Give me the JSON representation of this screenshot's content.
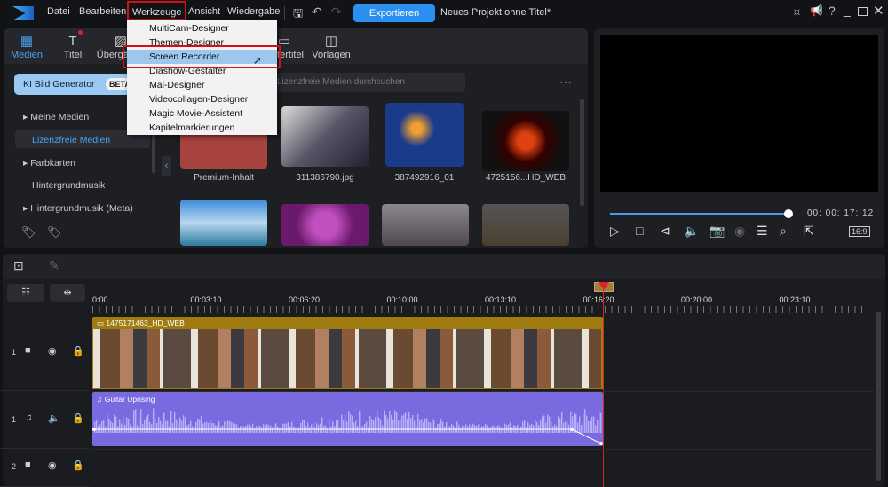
{
  "menubar": {
    "items": [
      "Datei",
      "Bearbeiten",
      "Werkzeuge",
      "Ansicht",
      "Wiedergabe"
    ],
    "export_label": "Exportieren",
    "project_title": "Neues Projekt ohne Titel*"
  },
  "werkzeuge_menu": {
    "items": [
      "MultiCam-Designer",
      "Themen-Designer",
      "Screen Recorder",
      "Diashow-Gestalter",
      "Mal-Designer",
      "Videocollagen-Designer",
      "Magic Movie-Assistent",
      "Kapitelmarkierungen"
    ],
    "highlighted": "Screen Recorder"
  },
  "tabs": [
    "Medien",
    "Titel",
    "Übergänge",
    "Untertitel",
    "Vorlagen"
  ],
  "ai_generator": {
    "label": "KI Bild Generator",
    "badge": "BETA"
  },
  "search": {
    "placeholder": "Lizenzfreie Medien durchsuchen"
  },
  "sidebar": {
    "items": [
      "Meine Medien",
      "Lizenzfreie Medien",
      "Farbkarten",
      "Hintergrundmusik",
      "Hintergrundmusik (Meta)"
    ],
    "active": "Lizenzfreie Medien"
  },
  "media": {
    "row1": [
      "Premium-Inhalt",
      "311386790.jpg",
      "387492916_01",
      "4725156...HD_WEB"
    ]
  },
  "preview": {
    "timecode": "00: 00: 17: 12",
    "aspect": "16:9",
    "progress": 0.97
  },
  "timeline": {
    "ruler": [
      "0:00",
      "00:03:10",
      "00:06:20",
      "00:10:00",
      "00:13:10",
      "00:16:20",
      "00:20:00",
      "00:23:10"
    ],
    "tracks": [
      {
        "num": "1",
        "type": "video",
        "clip": "1475171463_HD_WEB"
      },
      {
        "num": "1",
        "type": "audio",
        "clip": "Guitar Uprising"
      },
      {
        "num": "2",
        "type": "video",
        "clip": ""
      }
    ]
  },
  "colors": {
    "accent": "#2b8ff0",
    "video_clip": "#a07c10",
    "audio_clip": "#7a6ae0",
    "playhead": "#e0202a"
  }
}
